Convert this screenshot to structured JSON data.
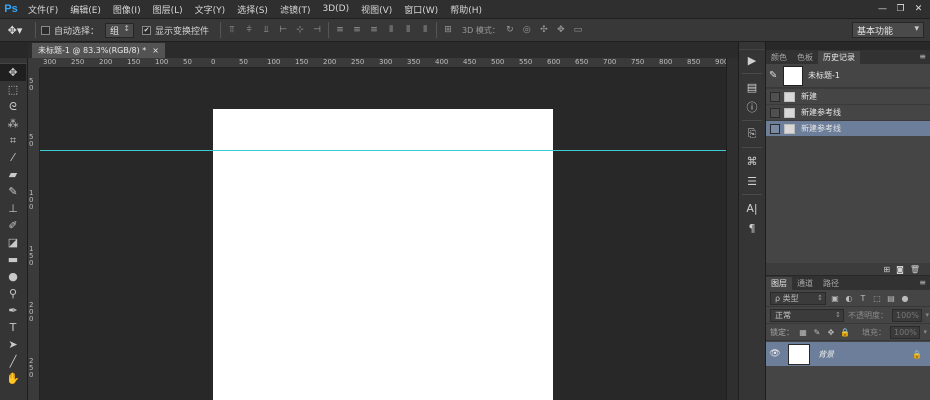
{
  "app": {
    "logo": "Ps"
  },
  "menu": [
    "文件(F)",
    "编辑(E)",
    "图像(I)",
    "图层(L)",
    "文字(Y)",
    "选择(S)",
    "滤镜(T)",
    "3D(D)",
    "视图(V)",
    "窗口(W)",
    "帮助(H)"
  ],
  "window_controls": {
    "minimize": "—",
    "restore": "❐",
    "close": "✕"
  },
  "options": {
    "auto_select_label": "自动选择：",
    "auto_select_value": "组",
    "show_transform_label": "显示变换控件",
    "show_transform_checked": "✔",
    "mode_3d_label": "3D 模式：",
    "workspace": "基本功能"
  },
  "document_tab": {
    "title": "未标题-1 @ 83.3%(RGB/8) *",
    "close": "×"
  },
  "ruler": {
    "h_labels": [
      "300",
      "250",
      "200",
      "150",
      "100",
      "50",
      "0",
      "50",
      "100",
      "150",
      "200",
      "250",
      "300",
      "350",
      "400",
      "450",
      "500",
      "550",
      "600",
      "650",
      "700",
      "750",
      "800",
      "850",
      "900"
    ],
    "v_labels": [
      "5 0",
      "5 0",
      "1 0 0",
      "1 5 0",
      "2 0 0",
      "2 5 0"
    ]
  },
  "history_panel": {
    "tabs": [
      "颜色",
      "色板",
      "历史记录"
    ],
    "active_tab": "历史记录",
    "snapshot": "未标题-1",
    "items": [
      {
        "label": "新建"
      },
      {
        "label": "新建参考线"
      },
      {
        "label": "新建参考线"
      }
    ]
  },
  "layers_panel": {
    "tabs": [
      "图层",
      "通道",
      "路径"
    ],
    "active_tab": "图层",
    "filter_kind": "ρ 类型",
    "blend_mode": "正常",
    "opacity_label": "不透明度：",
    "opacity_value": "100%",
    "lock_label": "锁定：",
    "fill_label": "填充：",
    "fill_value": "100%",
    "layers": [
      {
        "name": "背景",
        "visible": true,
        "locked": true
      }
    ]
  },
  "colors": {
    "accent_selection": "#6c7e99",
    "guide": "#3ec9d3",
    "ps_blue": "#31a8ff"
  }
}
